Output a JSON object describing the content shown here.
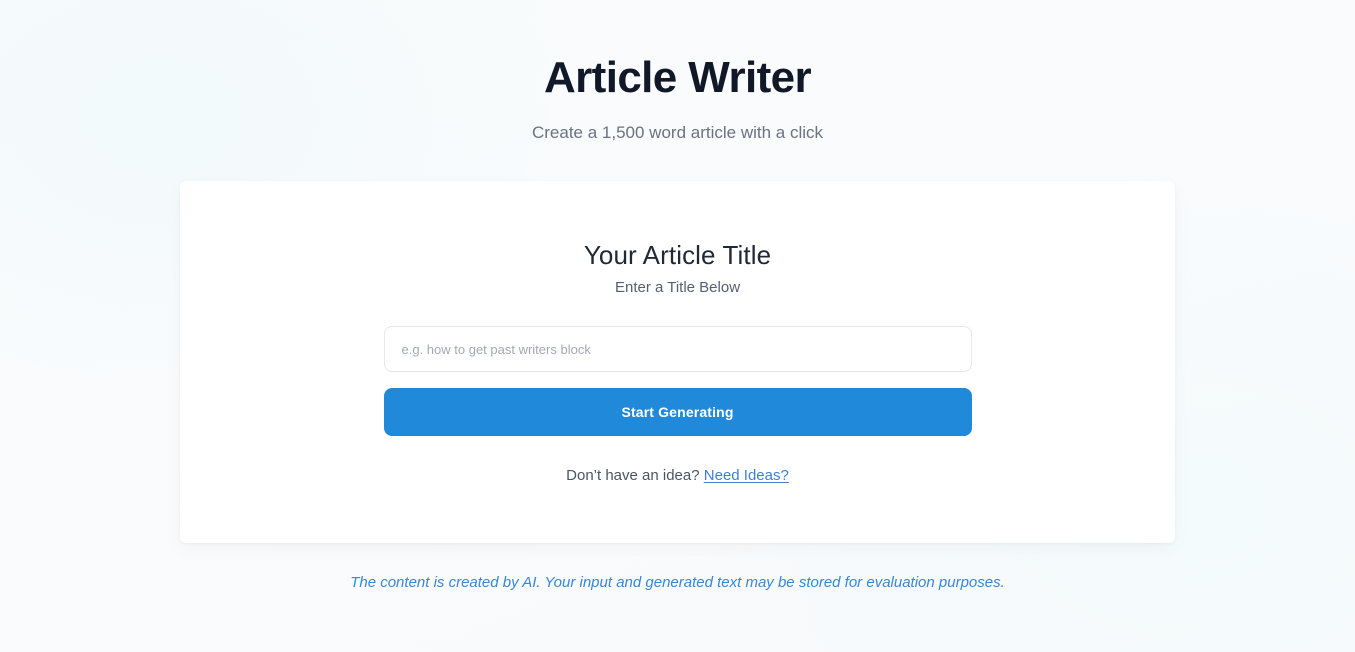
{
  "header": {
    "title": "Article Writer",
    "subtitle": "Create a 1,500 word article with a click"
  },
  "card": {
    "title": "Your Article Title",
    "subtitle": "Enter a Title Below",
    "input": {
      "placeholder": "e.g. how to get past writers block",
      "value": ""
    },
    "generate_button_label": "Start Generating",
    "idea_prompt": "Don’t have an idea?",
    "idea_link_label": "Need Ideas?"
  },
  "footer": {
    "disclaimer": "The content is created by AI. Your input and generated text may be stored for evaluation purposes."
  },
  "colors": {
    "accent": "#2189da",
    "link": "#3d7fd6",
    "title": "#111827",
    "muted": "#6b7280",
    "disclaimer": "#3787d8",
    "page_background": "#f8fbfc",
    "card_background": "#ffffff"
  }
}
